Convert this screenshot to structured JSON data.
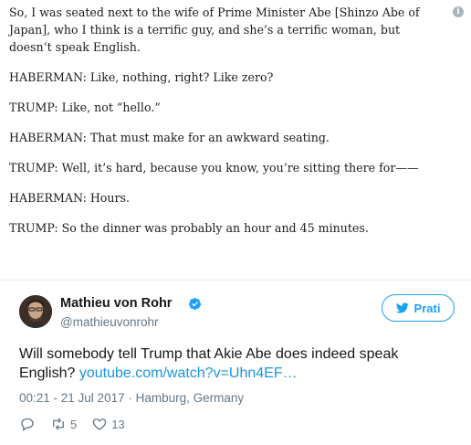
{
  "quote": {
    "paragraphs": [
      "So, I was seated next to the wife of Prime Minister Abe [Shinzo Abe of Japan], who I think is a terrific guy, and she’s a terrific woman, but doesn’t speak English.",
      "HABERMAN: Like, nothing, right? Like zero?",
      "TRUMP: Like, not “hello.”",
      "HABERMAN: That must make for an awkward seating.",
      "TRUMP: Well, it’s hard, because you know, you’re sitting there for——",
      "HABERMAN: Hours.",
      "TRUMP: So the dinner was probably an hour and 45 minutes."
    ]
  },
  "tweet": {
    "display_name": "Mathieu von Rohr",
    "username": "@mathieuvonrohr",
    "follow_label": "Prati",
    "text": "Will somebody tell Trump that Akie Abe does indeed speak English? ",
    "link": "youtube.com/watch?v=Uhn4EF…",
    "timestamp": "00:21 - 21 Jul 2017 · Hamburg, Germany",
    "retweet_count": "5",
    "like_count": "13"
  },
  "colors": {
    "accent": "#1da1f2",
    "link": "#1b95e0",
    "muted": "#657786",
    "text": "#14171a"
  },
  "icons": {
    "info": "info-icon",
    "verified": "verified-badge-icon",
    "bird": "twitter-bird-icon",
    "reply": "reply-icon",
    "retweet": "retweet-icon",
    "like": "heart-icon"
  }
}
